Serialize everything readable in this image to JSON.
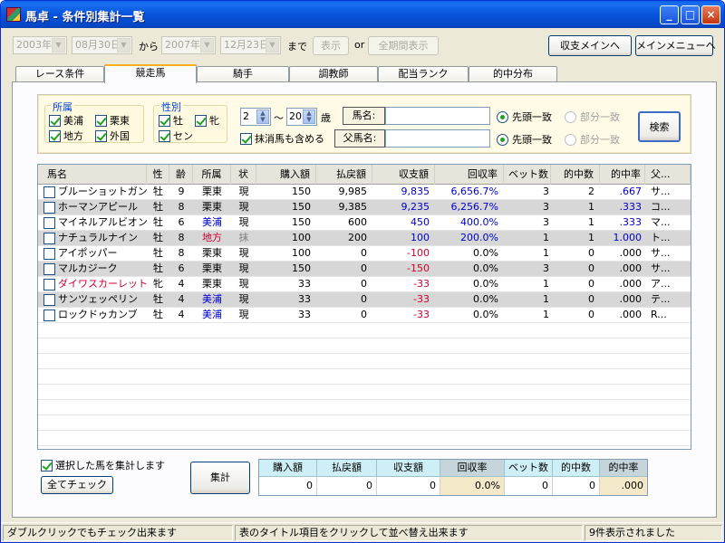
{
  "window": {
    "title": "馬卓 - 条件別集計一覧",
    "minimize": "_",
    "maximize": "□",
    "close": "×"
  },
  "toolbar": {
    "date_from_year": "2003年",
    "date_from_day": "08月30日",
    "from_label": "から",
    "date_to_year": "2007年",
    "date_to_day": "12月23日",
    "to_label": "まで",
    "show_button": "表示",
    "or_label": "or",
    "all_period_button": "全期間表示",
    "income_menu_button": "収支メインへ",
    "main_menu_button": "メインメニューへ"
  },
  "tabs": [
    "レース条件",
    "競走馬",
    "騎手",
    "調教師",
    "配当ランク",
    "的中分布"
  ],
  "filter": {
    "affiliation_title": "所属",
    "affiliation": [
      {
        "label": "美浦",
        "checked": true
      },
      {
        "label": "栗東",
        "checked": true
      },
      {
        "label": "地方",
        "checked": true
      },
      {
        "label": "外国",
        "checked": true
      }
    ],
    "sex_title": "性別",
    "sex": [
      {
        "label": "牡",
        "checked": true
      },
      {
        "label": "牝",
        "checked": true
      },
      {
        "label": "セン",
        "checked": true
      }
    ],
    "age_from": "2",
    "age_tilde": "～",
    "age_to": "20",
    "age_unit": "歳",
    "include_retired": "抹消馬も含める",
    "include_retired_checked": true,
    "horse_name_label": "馬名:",
    "horse_name_value": "",
    "sire_name_label": "父馬名:",
    "sire_name_value": "",
    "match_prefix": "先頭一致",
    "match_partial": "部分一致",
    "search_button": "検索"
  },
  "table": {
    "columns": [
      "馬名",
      "性",
      "齢",
      "所属",
      "状",
      "購入額",
      "払戻額",
      "収支額",
      "回収率",
      "ベット数",
      "的中数",
      "的中率",
      "父..."
    ],
    "rows": [
      {
        "name": "ブルーショットガン",
        "sex": "牡",
        "age": "9",
        "aff": "栗東",
        "status": "現",
        "buy": "150",
        "payout": "9,985",
        "balance": "9,835",
        "recovery": "6,656.7%",
        "bets": "3",
        "hits": "2",
        "rate": ".667",
        "sire": "サ..."
      },
      {
        "name": "ホーマンアピール",
        "sex": "牡",
        "age": "8",
        "aff": "栗東",
        "status": "現",
        "buy": "150",
        "payout": "9,385",
        "balance": "9,235",
        "recovery": "6,256.7%",
        "bets": "3",
        "hits": "1",
        "rate": ".333",
        "sire": "コ..."
      },
      {
        "name": "マイネルアルビオン",
        "sex": "牡",
        "age": "6",
        "aff": "美浦",
        "status": "現",
        "buy": "150",
        "payout": "600",
        "balance": "450",
        "recovery": "400.0%",
        "bets": "3",
        "hits": "1",
        "rate": ".333",
        "sire": "マ..."
      },
      {
        "name": "ナチュラルナイン",
        "sex": "牡",
        "age": "8",
        "aff": "地方",
        "status": "抹",
        "buy": "100",
        "payout": "200",
        "balance": "100",
        "recovery": "200.0%",
        "bets": "1",
        "hits": "1",
        "rate": "1.000",
        "sire": "ト..."
      },
      {
        "name": "アイポッパー",
        "sex": "牡",
        "age": "8",
        "aff": "栗東",
        "status": "現",
        "buy": "100",
        "payout": "0",
        "balance": "-100",
        "recovery": "0.0%",
        "bets": "1",
        "hits": "0",
        "rate": ".000",
        "sire": "サ..."
      },
      {
        "name": "マルカジーク",
        "sex": "牡",
        "age": "6",
        "aff": "栗東",
        "status": "現",
        "buy": "150",
        "payout": "0",
        "balance": "-150",
        "recovery": "0.0%",
        "bets": "3",
        "hits": "0",
        "rate": ".000",
        "sire": "サ..."
      },
      {
        "name": "ダイワスカーレット",
        "sex": "牝",
        "age": "4",
        "aff": "栗東",
        "status": "現",
        "buy": "33",
        "payout": "0",
        "balance": "-33",
        "recovery": "0.0%",
        "bets": "1",
        "hits": "0",
        "rate": ".000",
        "sire": "ア..."
      },
      {
        "name": "サンツェッペリン",
        "sex": "牡",
        "age": "4",
        "aff": "美浦",
        "status": "現",
        "buy": "33",
        "payout": "0",
        "balance": "-33",
        "recovery": "0.0%",
        "bets": "1",
        "hits": "0",
        "rate": ".000",
        "sire": "テ..."
      },
      {
        "name": "ロックドゥカンブ",
        "sex": "牡",
        "age": "4",
        "aff": "美浦",
        "status": "現",
        "buy": "33",
        "payout": "0",
        "balance": "-33",
        "recovery": "0.0%",
        "bets": "1",
        "hits": "0",
        "rate": ".000",
        "sire": "R..."
      }
    ]
  },
  "bottom": {
    "aggregate_selected": "選択した馬を集計します",
    "check_all_button": "全てチェック",
    "aggregate_button": "集計",
    "summary_headers": [
      "購入額",
      "払戻額",
      "収支額",
      "回収率",
      "ベット数",
      "的中数",
      "的中率"
    ],
    "summary_values": [
      "0",
      "0",
      "0",
      "0.0%",
      "0",
      "0",
      ".000"
    ]
  },
  "status": {
    "left": "ダブルクリックでもチェック出来ます",
    "mid": "表のタイトル項目をクリックして並べ替え出来ます",
    "right": "9件表示されました"
  },
  "colors": {
    "positive": "#0000cc",
    "negative": "#cc0033",
    "miho": "#0000cc",
    "local": "#cc0033",
    "retired": "#808080"
  }
}
